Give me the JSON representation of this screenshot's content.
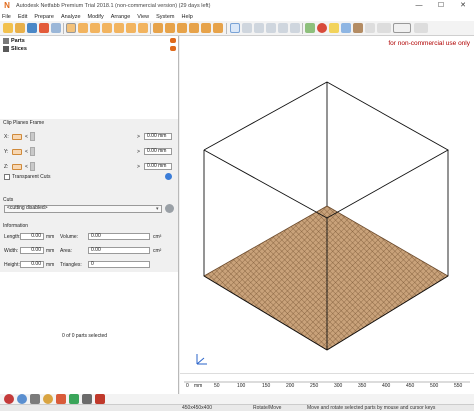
{
  "window": {
    "title": "Autodesk Netfabb Premium Trial 2018.1 (non-commercial version) (29 days left)",
    "minimize": "—",
    "maximize": "☐",
    "close": "✕"
  },
  "menu": [
    "File",
    "Edit",
    "Prepare",
    "Analyze",
    "Modify",
    "Arrange",
    "View",
    "System",
    "Help"
  ],
  "tree": {
    "parts": "Parts",
    "slices": "Slices"
  },
  "clip_planes": {
    "header": "Clip Planes Frame",
    "x_label": "X:",
    "y_label": "Y:",
    "z_label": "Z:",
    "lt": "<",
    "gt": ">",
    "x_value": "0.00 mm",
    "y_value": "0.00 mm",
    "z_value": "0.00 mm",
    "transparent_cuts": "Transparent Cuts"
  },
  "cuts": {
    "header": "Cuts",
    "selected": "<cutting disabled>"
  },
  "information": {
    "header": "Information",
    "length_label": "Length:",
    "length_value": "0.00",
    "length_unit": "mm",
    "volume_label": "Volume:",
    "volume_value": "0.00",
    "volume_unit": "cm³",
    "width_label": "Width:",
    "width_value": "0.00",
    "width_unit": "mm",
    "area_label": "Area:",
    "area_value": "0.00",
    "area_unit": "cm²",
    "height_label": "Height:",
    "height_value": "0.00",
    "height_unit": "mm",
    "triangles_label": "Triangles:",
    "triangles_value": "0"
  },
  "selection_status": "0 of 0 parts selected",
  "viewport": {
    "notice": "for non-commercial use only"
  },
  "ruler": {
    "unit": "mm",
    "ticks": [
      "0",
      "50",
      "100",
      "150",
      "200",
      "250",
      "300",
      "350",
      "400",
      "450",
      "500",
      "550"
    ]
  },
  "status": {
    "dims": "450x450x400",
    "mode": "Rotate/Move",
    "hint": "Move and rotate selected parts by mouse and cursor keys"
  },
  "colors": {
    "accent": "#e06a1b",
    "plate": "#c49a6c",
    "notice": "#b00000"
  }
}
